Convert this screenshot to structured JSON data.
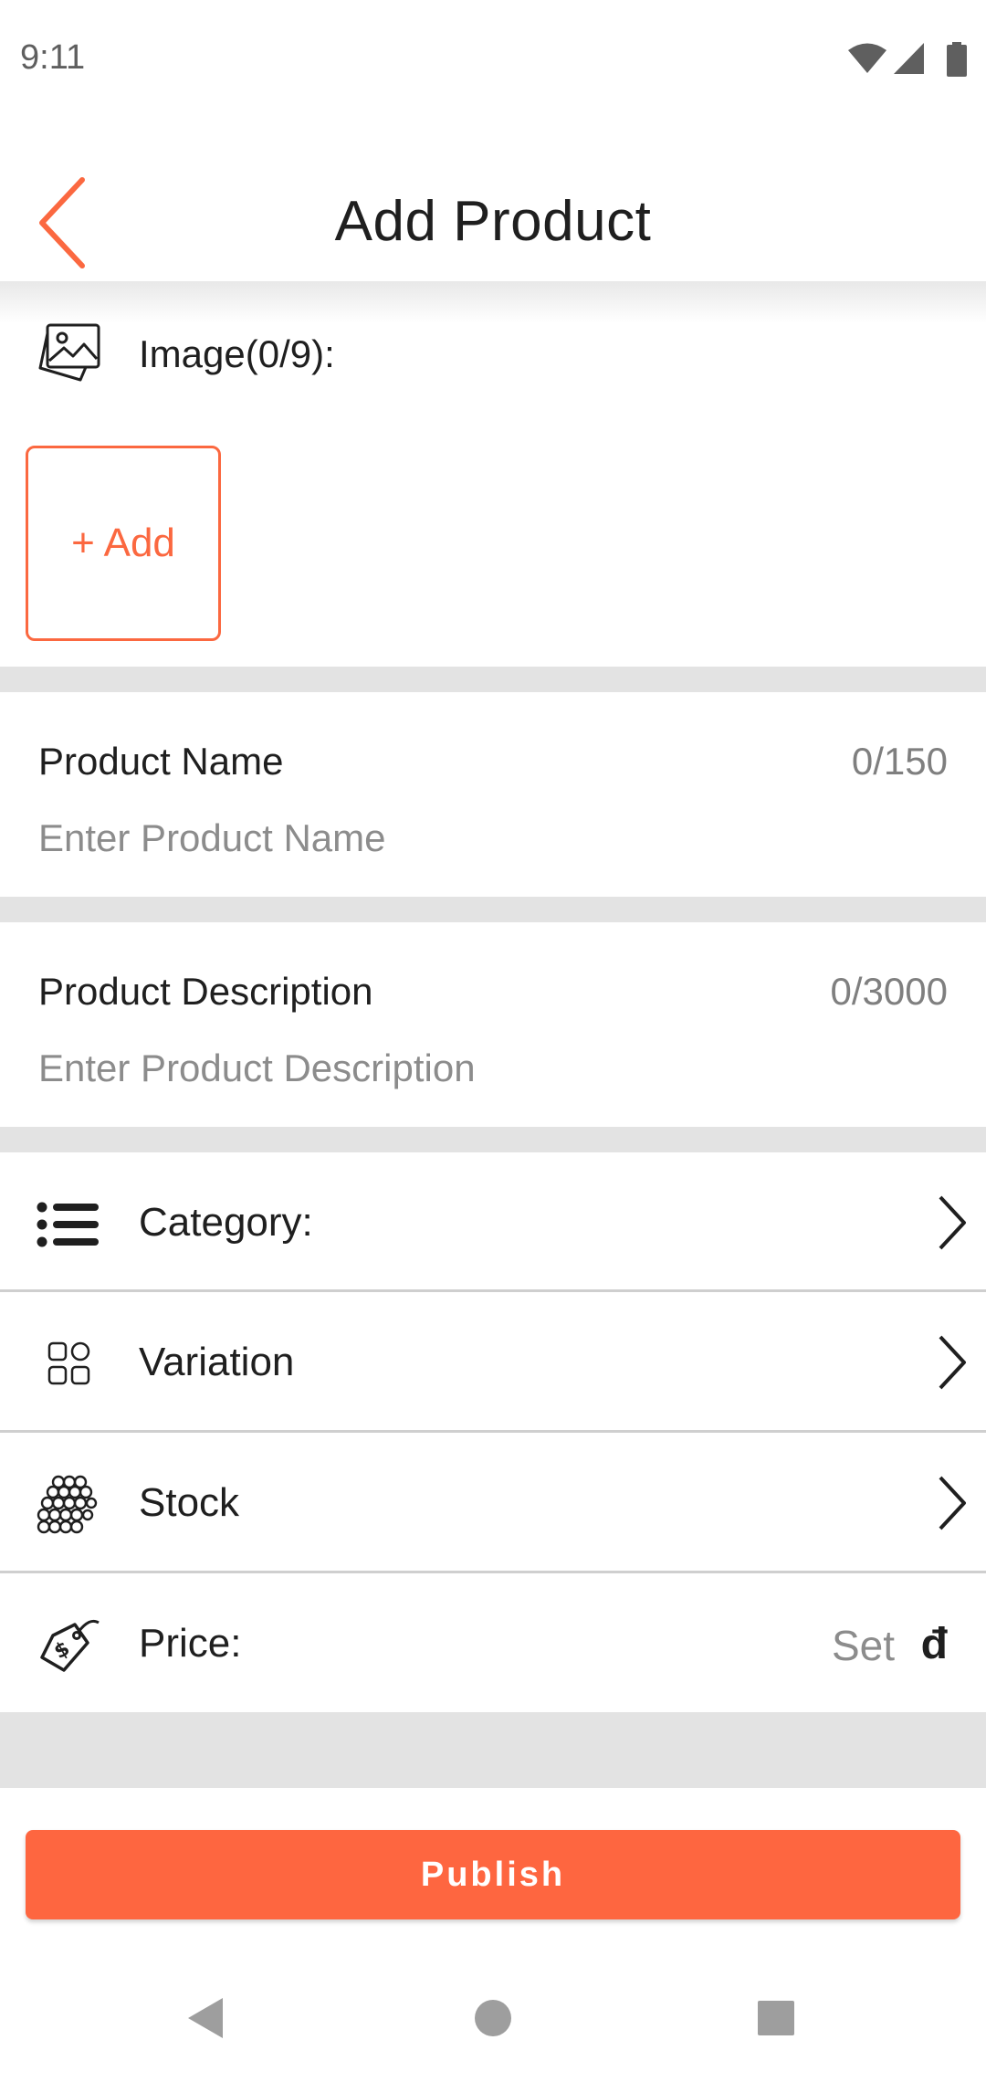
{
  "status_bar": {
    "time": "9:11",
    "icons": [
      "wifi-icon",
      "cell-signal-icon",
      "battery-icon"
    ]
  },
  "app_bar": {
    "title": "Add Product",
    "back_icon": "chevron-left-icon",
    "accent_color": "#fb6840"
  },
  "images": {
    "label": "Image(0/9):",
    "icon": "image-gallery-icon",
    "add_button": "+ Add"
  },
  "product_name": {
    "label": "Product Name",
    "counter": "0/150",
    "value": "",
    "placeholder": "Enter Product Name"
  },
  "product_description": {
    "label": "Product Description",
    "counter": "0/3000",
    "value": "",
    "placeholder": "Enter Product Description"
  },
  "menu": {
    "category": {
      "label": "Category:",
      "icon": "list-icon"
    },
    "variation": {
      "label": "Variation",
      "icon": "grid-squares-icon"
    },
    "stock": {
      "label": "Stock",
      "icon": "stock-stack-icon"
    },
    "price": {
      "label": "Price:",
      "icon": "price-tag-icon",
      "value": "Set",
      "currency": "đ"
    }
  },
  "publish_button": {
    "label": "Publish",
    "color": "#fe6640"
  },
  "nav_bar": {
    "icons": [
      "back-triangle-icon",
      "home-circle-icon",
      "recents-square-icon"
    ]
  }
}
